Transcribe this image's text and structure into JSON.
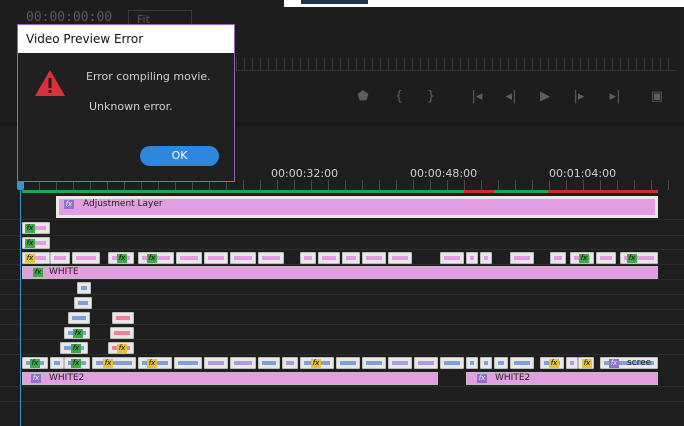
{
  "monitor": {
    "timecode": "00:00:00:00",
    "fit": "Fit"
  },
  "timeline": {
    "ticks": [
      "00:00:32:00",
      "00:00:48:00",
      "00:01:04:00"
    ],
    "clips": {
      "adjustment_layer": "Adjustment Layer",
      "white": "WHITE",
      "white2_a": "WHITE2",
      "white2_b": "WHITE2",
      "scree": "scree",
      "fx": "fx"
    }
  },
  "dialog": {
    "title": "Video Preview Error",
    "message": "Error compiling movie.",
    "detail": "Unknown error.",
    "ok_label": "OK"
  },
  "colors": {
    "accent": "#2e86de",
    "dialog_border": "#9b5fbf",
    "warning": "#d9303a",
    "clip_pink": "#e79be3",
    "clip_blue": "#7fa0d6"
  }
}
